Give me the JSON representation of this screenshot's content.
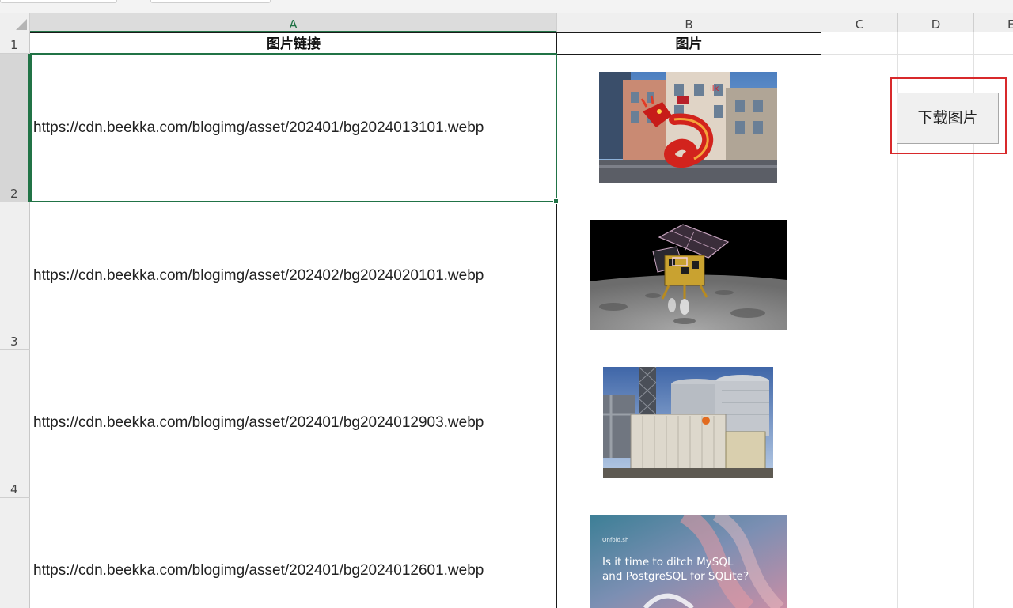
{
  "sheet": {
    "columns": [
      "A",
      "B",
      "C",
      "D",
      "E"
    ],
    "rows": [
      "1",
      "2",
      "3",
      "4"
    ],
    "headers": {
      "link": "图片链接",
      "image": "图片"
    },
    "urls": [
      "https://cdn.beekka.com/blogimg/asset/202401/bg2024013101.webp",
      "https://cdn.beekka.com/blogimg/asset/202402/bg2024020101.webp",
      "https://cdn.beekka.com/blogimg/asset/202401/bg2024012903.webp",
      "https://cdn.beekka.com/blogimg/asset/202401/bg2024012601.webp"
    ],
    "selected_cell": "A2"
  },
  "images": [
    {
      "subject": "street-with-red-dragon-sculpture"
    },
    {
      "subject": "lunar-lander-over-moon-surface"
    },
    {
      "subject": "industrial-container-and-silos"
    },
    {
      "subject": "article-cover",
      "small_text": "Onfold.sh",
      "headline_line1": "Is it time to ditch MySQL",
      "headline_line2": "and PostgreSQL for SQLite?"
    }
  ],
  "download_button": {
    "label": "下载图片"
  },
  "colors": {
    "selection": "#217346",
    "highlight": "#d8292b"
  }
}
